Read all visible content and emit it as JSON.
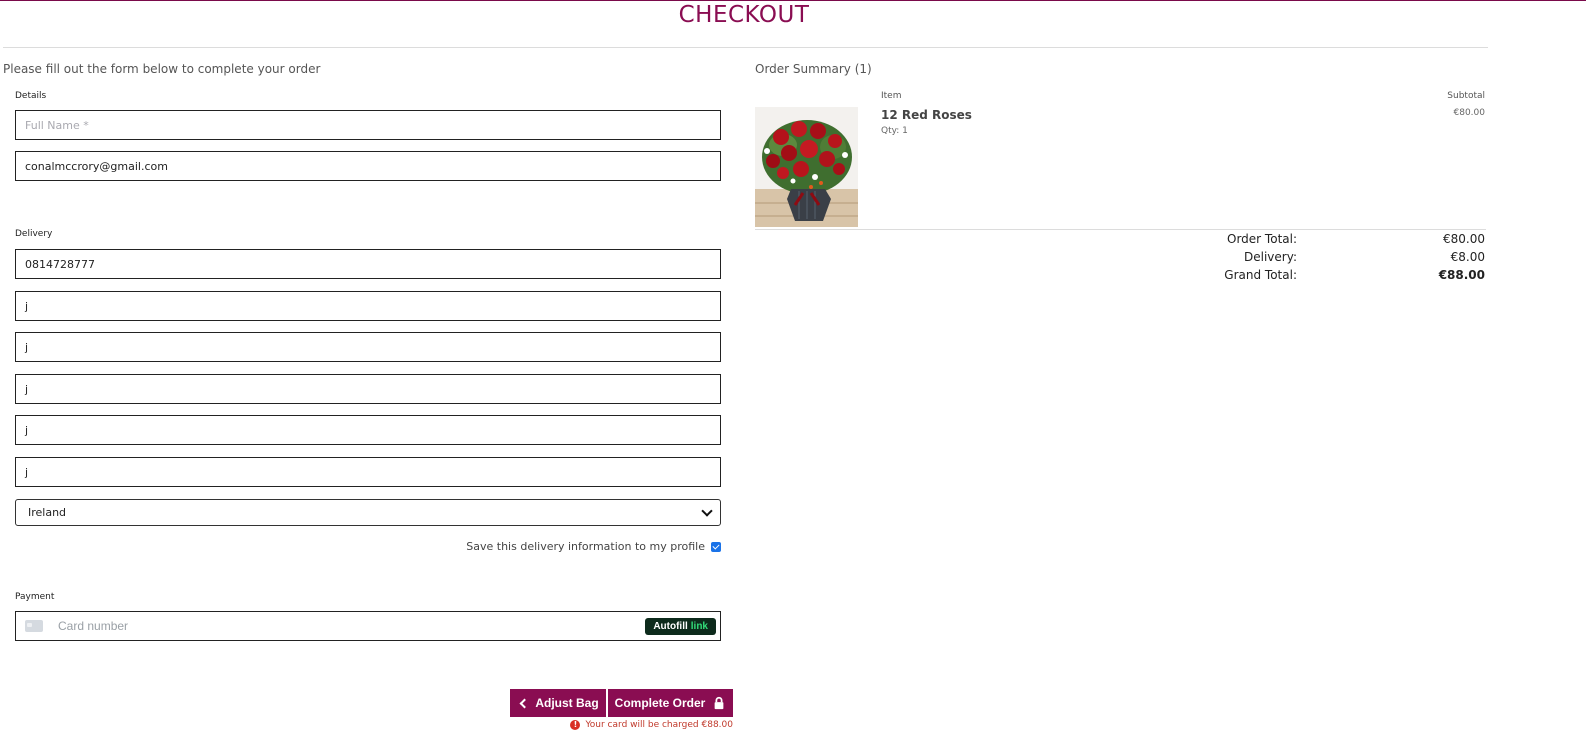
{
  "page": {
    "title": "CHECKOUT"
  },
  "form": {
    "intro": "Please fill out the form below to complete your order",
    "details_label": "Details",
    "full_name_placeholder": "Full Name *",
    "email_value": "conalmccrory@gmail.com",
    "delivery_label": "Delivery",
    "phone_value": "0814728777",
    "address_fields": [
      "j",
      "j",
      "j",
      "j",
      "j"
    ],
    "country_selected": "Ireland",
    "save_info_label": "Save this delivery information to my profile",
    "save_info_checked": true,
    "payment_label": "Payment",
    "card_placeholder": "Card number",
    "autofill_text": "Autofill",
    "autofill_link": "link"
  },
  "actions": {
    "adjust_bag": "Adjust Bag",
    "complete_order": "Complete Order",
    "charge_note": "Your card will be charged €88.00"
  },
  "summary": {
    "heading": "Order Summary (1)",
    "col_item": "Item",
    "col_subtotal": "Subtotal",
    "items": [
      {
        "name": "12 Red Roses",
        "qty": "Qty: 1",
        "subtotal": "€80.00",
        "image": "red-roses-bouquet"
      }
    ],
    "order_total_label": "Order Total:",
    "order_total": "€80.00",
    "delivery_label": "Delivery:",
    "delivery": "€8.00",
    "grand_total_label": "Grand Total:",
    "grand_total": "€88.00"
  },
  "colors": {
    "brand": "#8a0d52",
    "error": "#d93025",
    "checkbox": "#1a73e8"
  }
}
